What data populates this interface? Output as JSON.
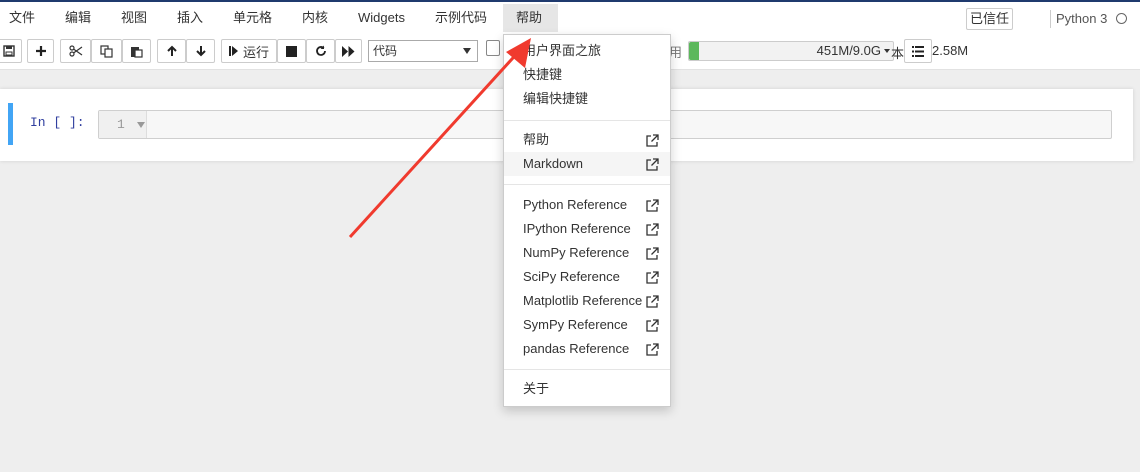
{
  "menubar": {
    "items": [
      {
        "label": "文件"
      },
      {
        "label": "编辑"
      },
      {
        "label": "视图"
      },
      {
        "label": "插入"
      },
      {
        "label": "单元格"
      },
      {
        "label": "内核"
      },
      {
        "label": "Widgets"
      },
      {
        "label": "示例代码"
      },
      {
        "label": "帮助",
        "active": true
      }
    ],
    "trusted_label": "已信任",
    "kernel_name": "Python 3"
  },
  "toolbar": {
    "run_label": "运行",
    "cell_type": "代码",
    "memory_label": "用",
    "memory_text": "451M/9.0G",
    "memory_fraction": 0.049,
    "ben_label": "本",
    "disk_text": "2.58M",
    "icons": [
      "save-icon",
      "plus-icon",
      "cut-icon",
      "copy-icon",
      "paste-icon",
      "arrow-up-icon",
      "arrow-down-icon",
      "step-icon",
      "stop-icon",
      "restart-icon",
      "fast-forward-icon",
      "list-icon"
    ]
  },
  "cell": {
    "prompt": "In [ ]:",
    "line_number": "1"
  },
  "help_menu": {
    "group1": [
      "用户界面之旅",
      "快捷键",
      "编辑快捷键"
    ],
    "group2": [
      "帮助",
      "Markdown"
    ],
    "group3": [
      "Python Reference",
      "IPython Reference",
      "NumPy Reference",
      "SciPy Reference",
      "Matplotlib Reference",
      "SymPy Reference",
      "pandas Reference"
    ],
    "group4": [
      "关于"
    ],
    "hovered": "Markdown",
    "external_icon": "external-link-icon"
  },
  "annotation": {
    "arrow_color": "#f03a2e"
  }
}
